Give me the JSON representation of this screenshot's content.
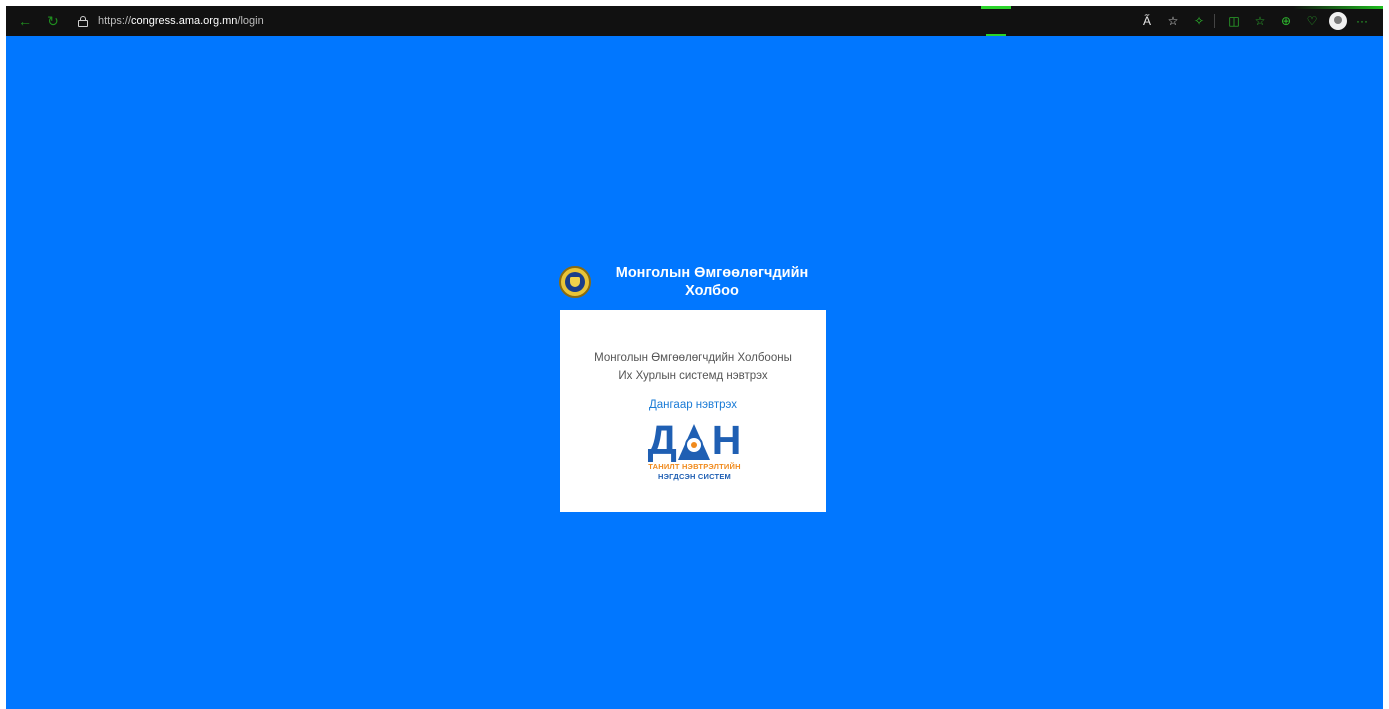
{
  "browser": {
    "url_scheme": "https://",
    "url_host": "congress.ama.org.mn",
    "url_path": "/login",
    "icons": [
      "back-icon",
      "reload-icon",
      "lock-icon",
      "read-aloud-icon",
      "favorite-icon",
      "extension-icon",
      "split-screen-icon",
      "favorites-list-icon",
      "collections-icon",
      "performance-icon",
      "profile-icon",
      "more-icon"
    ],
    "accent_color": "#2fbf2f"
  },
  "page": {
    "background_color": "#0177ff",
    "brand": {
      "title": "Монголын Өмгөөлөгчдийн Холбоо"
    },
    "card": {
      "description_line1": "Монголын Өмгөөлөгчдийн Холбооны",
      "description_line2": "Их Хурлын системд нэвтрэх",
      "login_link": "Дангаар нэвтрэх",
      "dan_logo": {
        "letters_left": "Д",
        "letters_right": "Н",
        "line1": "ТАНИЛТ НЭВТРЭЛТИЙН",
        "line2": "НЭГДСЭН СИСТЕМ"
      }
    }
  }
}
